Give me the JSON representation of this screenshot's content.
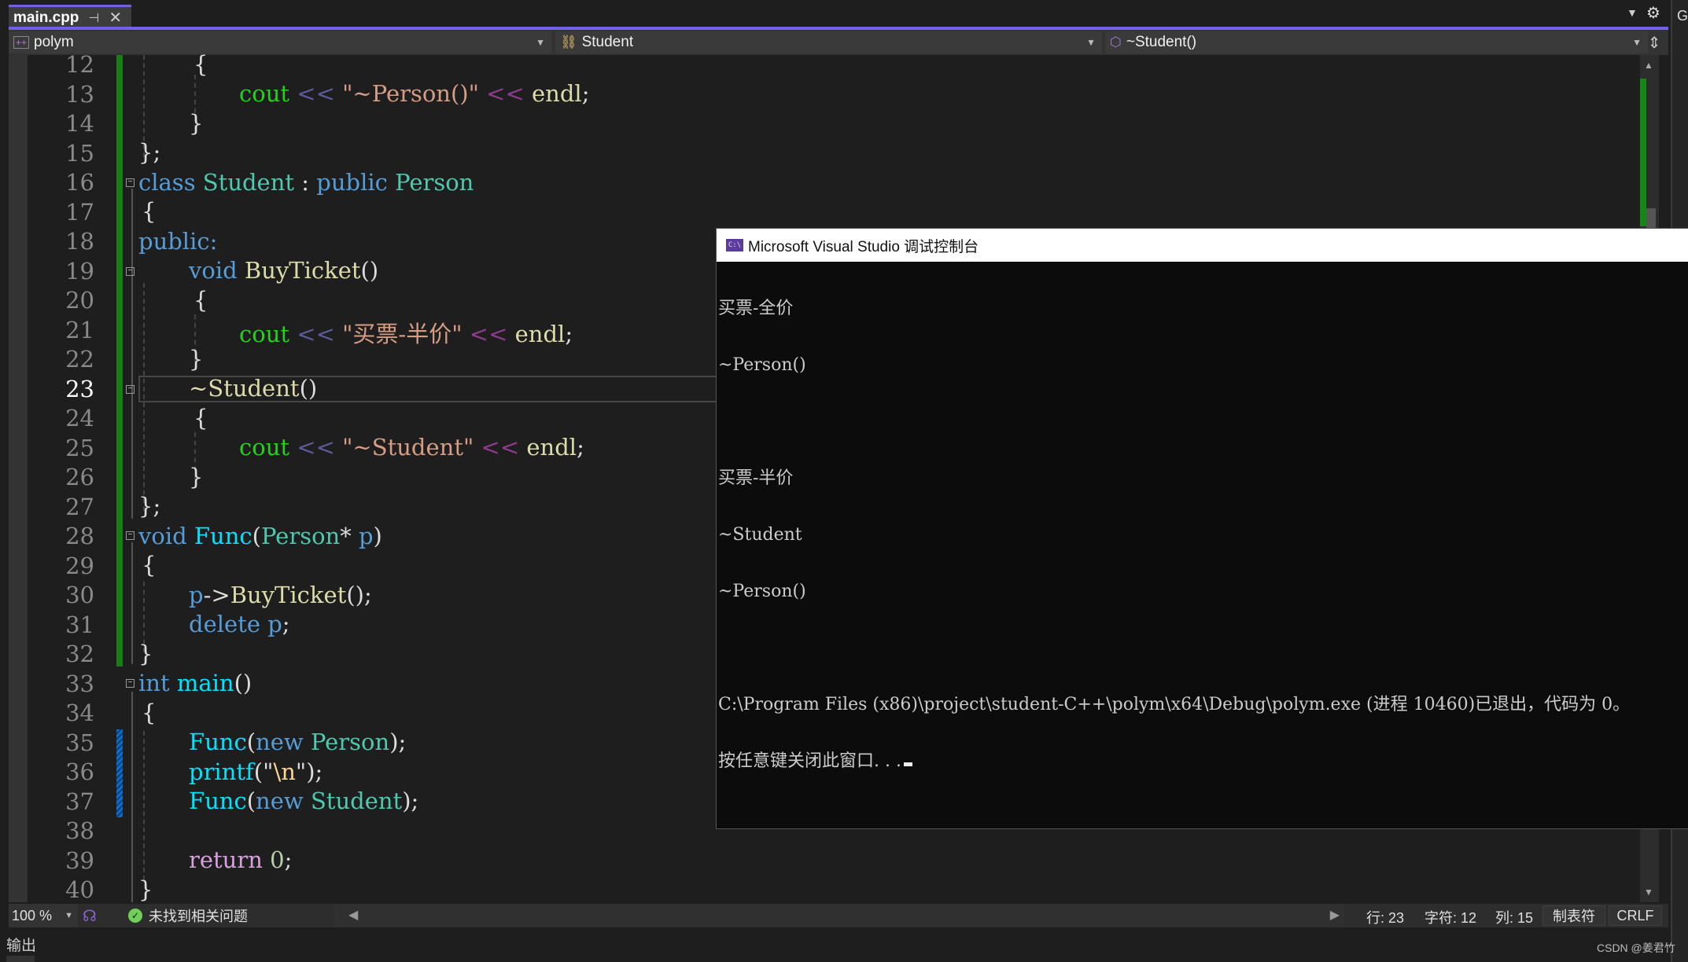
{
  "tab": {
    "title": "main.cpp",
    "pin_icon": "pin-icon",
    "close_icon": "close-icon"
  },
  "navbar": {
    "project": "polym",
    "scope": "Student",
    "member": "~Student()"
  },
  "editor": {
    "current_line": 23,
    "lines": [
      {
        "n": "12"
      },
      {
        "n": "13"
      },
      {
        "n": "14"
      },
      {
        "n": "15"
      },
      {
        "n": "16"
      },
      {
        "n": "17"
      },
      {
        "n": "18"
      },
      {
        "n": "19"
      },
      {
        "n": "20"
      },
      {
        "n": "21"
      },
      {
        "n": "22"
      },
      {
        "n": "23"
      },
      {
        "n": "24"
      },
      {
        "n": "25"
      },
      {
        "n": "26"
      },
      {
        "n": "27"
      },
      {
        "n": "28"
      },
      {
        "n": "29"
      },
      {
        "n": "30"
      },
      {
        "n": "31"
      },
      {
        "n": "32"
      },
      {
        "n": "33"
      },
      {
        "n": "34"
      },
      {
        "n": "35"
      },
      {
        "n": "36"
      },
      {
        "n": "37"
      },
      {
        "n": "38"
      },
      {
        "n": "39"
      },
      {
        "n": "40"
      }
    ],
    "code": {
      "l12": "{",
      "l13_cout": "cout",
      "l13_op": "<<",
      "l13_str": "\"~Person()\"",
      "l13_op2": "<<",
      "l13_endl": "endl",
      "l13_semi": ";",
      "l14": "}",
      "l15": "};",
      "l16_kw": "class",
      "l16_ty": "Student",
      "l16_colon": ":",
      "l16_kw2": "public",
      "l16_ty2": "Person",
      "l17": "{",
      "l18": "public:",
      "l19_kw": "void",
      "l19_fn": "BuyTicket",
      "l19_par": "()",
      "l20": "{",
      "l21_cout": "cout",
      "l21_op": "<<",
      "l21_str": "\"买票-半价\"",
      "l21_op2": "<<",
      "l21_endl": "endl",
      "l21_semi": ";",
      "l22": "}",
      "l23_fn": "~Student",
      "l23_par": "()",
      "l24": "{",
      "l25_cout": "cout",
      "l25_op": "<<",
      "l25_str": "\"~Student\"",
      "l25_op2": "<<",
      "l25_endl": "endl",
      "l25_semi": ";",
      "l26": "}",
      "l27": "};",
      "l28_kw": "void",
      "l28_fn": "Func",
      "l28_p1": "(",
      "l28_ty": "Person",
      "l28_star": "*",
      "l28_p": "p",
      "l28_p2": ")",
      "l29": "{",
      "l30_p": "p",
      "l30_arrow": "->",
      "l30_fn": "BuyTicket",
      "l30_rest": "();",
      "l31_kw": "delete",
      "l31_p": "p",
      "l31_semi": ";",
      "l32": "}",
      "l33_kw": "int",
      "l33_fn": "main",
      "l33_par": "()",
      "l34": "{",
      "l35_fn": "Func",
      "l35_p1": "(",
      "l35_kw": "new",
      "l35_ty": "Person",
      "l35_rest": ");",
      "l36_fn": "printf",
      "l36_p1": "(\"",
      "l36_esc": "\\n",
      "l36_rest": "\");",
      "l37_fn": "Func",
      "l37_p1": "(",
      "l37_kw": "new",
      "l37_ty": "Student",
      "l37_rest": ");",
      "l39_kw": "return",
      "l39_num": "0",
      "l39_semi": ";",
      "l40": "}"
    }
  },
  "console": {
    "title": "Microsoft Visual Studio 调试控制台",
    "icon": "console-app-icon",
    "lines": [
      "买票-全价",
      "~Person()",
      "",
      "买票-半价",
      "~Student",
      "~Person()",
      "",
      "C:\\Program Files (x86)\\project\\student-C++\\polym\\x64\\Debug\\polym.exe (进程 10460)已退出，代码为 0。",
      "按任意键关闭此窗口. . ."
    ]
  },
  "statusbar": {
    "zoom": "100 %",
    "issues": "未找到相关问题",
    "row": "行: 23",
    "char": "字符: 12",
    "col": "列: 15",
    "indent": "制表符",
    "eol": "CRLF"
  },
  "panels": {
    "output": "输出",
    "git_tab": "Gi"
  },
  "watermark": "CSDN @姜君竹",
  "colors": {
    "accent": "#7160e8",
    "change_bar": "#1b7d16",
    "saved_bar": "#0a6fd0"
  }
}
